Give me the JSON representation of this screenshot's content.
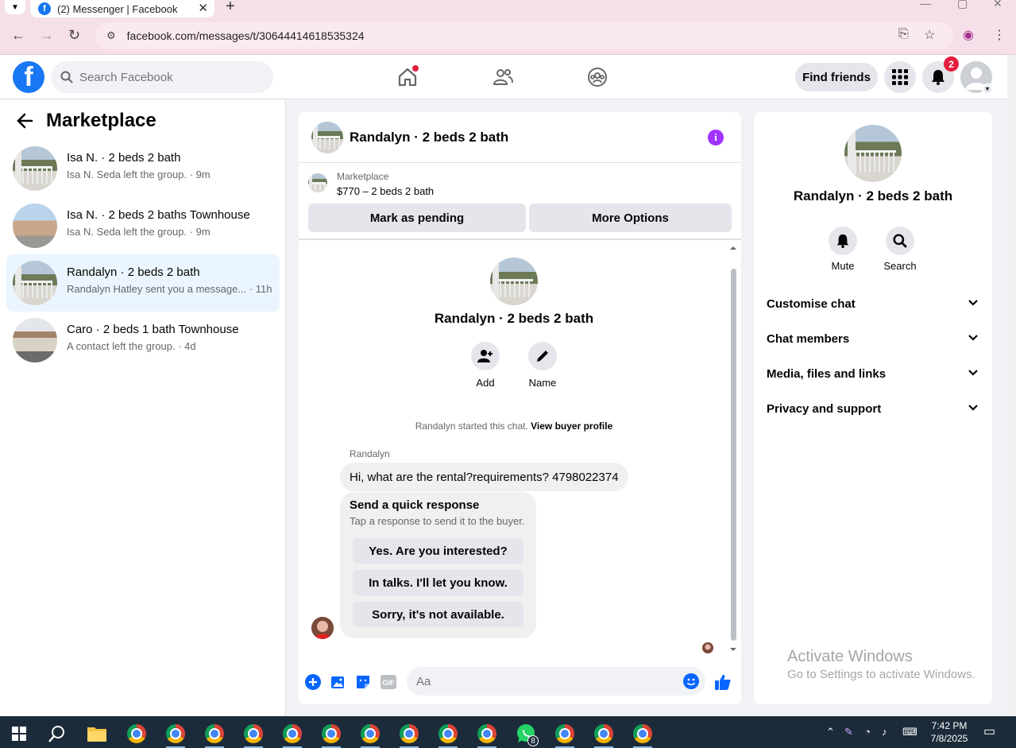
{
  "browser": {
    "tab_title": "(2) Messenger | Facebook",
    "tab_favicon": "f",
    "url": "facebook.com/messages/t/30644414618535324"
  },
  "header": {
    "logo": "f",
    "search_placeholder": "Search Facebook",
    "find_friends_label": "Find friends",
    "notification_count": "2",
    "accent_color": "#1877f2"
  },
  "sidebar": {
    "title": "Marketplace",
    "conversations": [
      {
        "title": "Isa N. · 2 beds 2 bath",
        "subtitle": "Isa N. Seda left the group. · 9m",
        "active": false
      },
      {
        "title": "Isa N. · 2 beds 2 baths Townhouse",
        "subtitle": "Isa N. Seda left the group. · 9m",
        "active": false
      },
      {
        "title": "Randalyn · 2 beds 2 bath",
        "subtitle": "Randalyn Hatley sent you a message... · 11h",
        "active": true
      },
      {
        "title": "Caro · 2 beds 1 bath Townhouse",
        "subtitle": "A contact left the group. · 4d",
        "active": false
      }
    ]
  },
  "chat": {
    "title": "Randalyn · 2 beds 2 bath",
    "listing_label": "Marketplace",
    "listing_price": "$770 – 2 beds 2 bath",
    "mark_pending_label": "Mark as pending",
    "more_options_label": "More Options",
    "intro_title": "Randalyn · 2 beds 2 bath",
    "add_label": "Add",
    "name_label": "Name",
    "started_text": "Randalyn started this chat.",
    "buyer_profile_link": "View buyer profile",
    "sender_name": "Randalyn",
    "message": "Hi, what are the rental?requirements? 4798022374",
    "quick_title": "Send a quick response",
    "quick_subtitle": "Tap a response to send it to the buyer.",
    "quick_responses": [
      "Yes. Are you interested?",
      "In talks. I'll let you know.",
      "Sorry, it's not available."
    ],
    "composer_placeholder": "Aa"
  },
  "details": {
    "title": "Randalyn · 2 beds 2 bath",
    "mute_label": "Mute",
    "search_label": "Search",
    "sections": [
      "Customise chat",
      "Chat members",
      "Media, files and links",
      "Privacy and support"
    ]
  },
  "watermark": {
    "line1": "Activate Windows",
    "line2": "Go to Settings to activate Windows."
  },
  "taskbar": {
    "time": "7:42 PM",
    "date": "7/8/2025",
    "whatsapp_badge": "8"
  }
}
